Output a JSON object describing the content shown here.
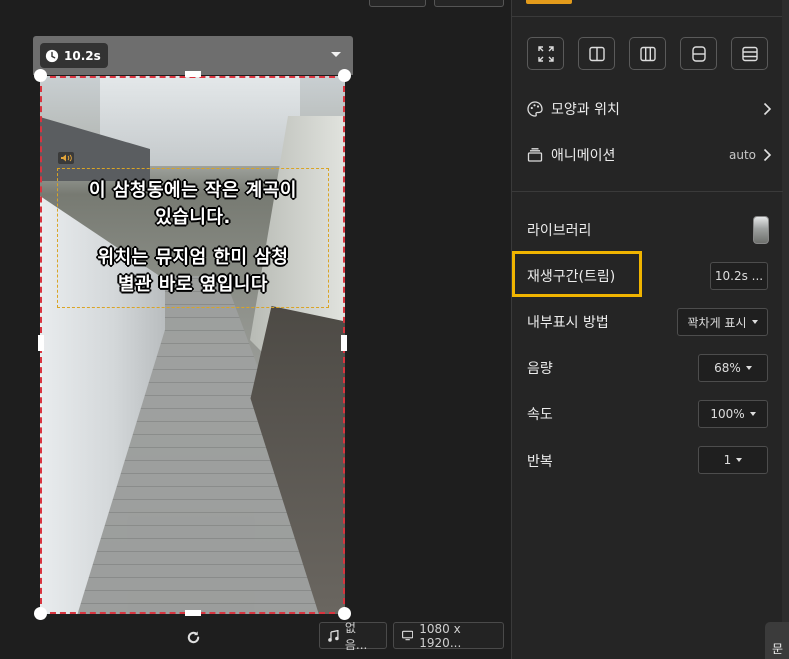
{
  "canvas": {
    "duration_label": "10.2s",
    "subtitle_lines": [
      "이 삼청동에는 작은 계곡이",
      "있습니다.",
      "위치는 뮤지엄 한미 삼청",
      "별관 바로 옆입니다"
    ],
    "music_button_label": "없음...",
    "resolution_button_label": "1080 x 1920..."
  },
  "panel": {
    "layout_icons": [
      "fit-screen-icon",
      "split-two-icon",
      "split-three-icon",
      "split-horizontal-icon",
      "split-rows-icon"
    ],
    "appearance_label": "모양과 위치",
    "animation_label": "애니메이션",
    "animation_value": "auto",
    "library_label": "라이브러리",
    "trim_label": "재생구간(트림)",
    "trim_value": "10.2s ...",
    "display_mode_label": "내부표시 방법",
    "display_mode_value": "꽉차게 표시",
    "volume_label": "음량",
    "volume_value": "68%",
    "speed_label": "속도",
    "speed_value": "100%",
    "repeat_label": "반복",
    "repeat_value": "1",
    "corner_tab_label": "문"
  },
  "colors": {
    "accent_orange": "#e39b1b",
    "highlight_yellow": "#f0b400",
    "selection_red": "#d9343f",
    "text_box_dash": "#d9a425"
  }
}
